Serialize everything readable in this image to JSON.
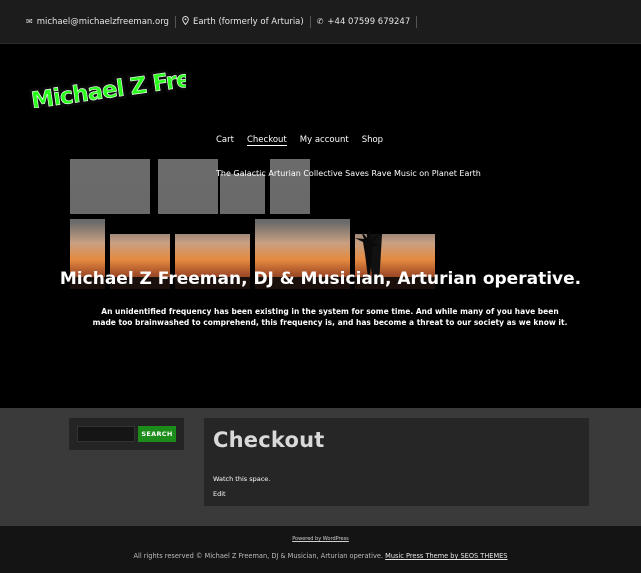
{
  "topbar": {
    "email": "michael@michaelzfreeman.org",
    "location": "Earth (formerly of Arturia)",
    "phone": "+44 07599 679247"
  },
  "logo_text": "Michael Z Freeman",
  "nav": [
    "Cart",
    "Checkout",
    "My account",
    "Shop"
  ],
  "tagline": "The Galactic Arturian Collective Saves Rave Music on Planet Earth",
  "headline": "Michael Z Freeman, DJ & Musician, Arturian operative.",
  "intro": "An unidentified frequency has been existing in the system for some time. And while many of you have been made too brainwashed to comprehend, this frequency is, and has become a threat to our society as we know it.",
  "search": {
    "button_label": "SEARCH",
    "placeholder": ""
  },
  "page": {
    "title": "Checkout",
    "body": "Watch this space.",
    "edit": "Edit"
  },
  "footer": {
    "powered": "Powered by WordPress",
    "rights_prefix": "All rights reserved © Michael Z Freeman, DJ & Musician, Arturian operative.",
    "theme_link": "Music Press Theme by SEOS THEMES"
  },
  "colors": {
    "accent_green": "#1c8c1a",
    "logo_green": "#2bff1e"
  }
}
